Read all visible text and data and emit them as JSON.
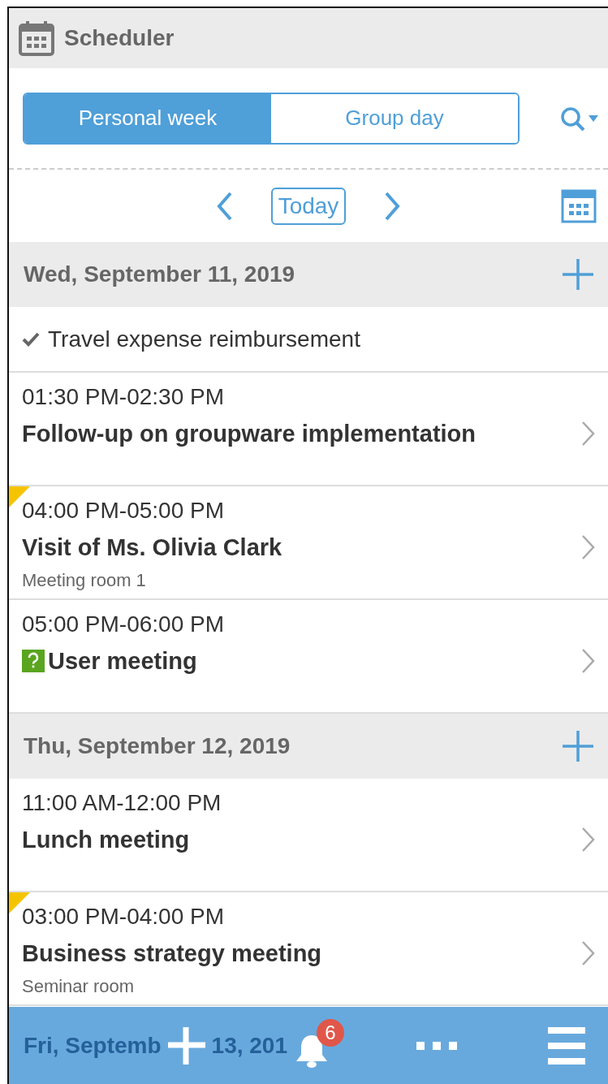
{
  "header": {
    "title": "Scheduler"
  },
  "view_tabs": [
    {
      "label": "Personal week",
      "selected": true
    },
    {
      "label": "Group day",
      "selected": false
    }
  ],
  "nav": {
    "today": "Today"
  },
  "days": [
    {
      "date": "Wed, September 11, 2019",
      "todos": [
        {
          "label": "Travel expense reimbursement",
          "checked": true
        }
      ],
      "events": [
        {
          "time": "01:30 PM-02:30 PM",
          "title": "Follow-up on groupware implementation",
          "updated": false,
          "unconfirmed": false
        },
        {
          "time": "04:00 PM-05:00 PM",
          "title": "Visit of Ms. Olivia Clark",
          "location": "Meeting room 1",
          "updated": true,
          "unconfirmed": false
        },
        {
          "time": "05:00 PM-06:00 PM",
          "title": "User meeting",
          "updated": false,
          "unconfirmed": true
        }
      ]
    },
    {
      "date": "Thu, September 12, 2019",
      "events": [
        {
          "time": "11:00 AM-12:00 PM",
          "title": "Lunch meeting",
          "updated": false,
          "unconfirmed": false
        },
        {
          "time": "03:00 PM-04:00 PM",
          "title": "Business strategy meeting",
          "location": "Seminar room",
          "updated": true,
          "unconfirmed": false
        }
      ]
    },
    {
      "date_visible_parts": [
        "Fri, Septemb",
        "13, 201"
      ]
    }
  ],
  "bottom_bar": {
    "notification_count": "6"
  }
}
